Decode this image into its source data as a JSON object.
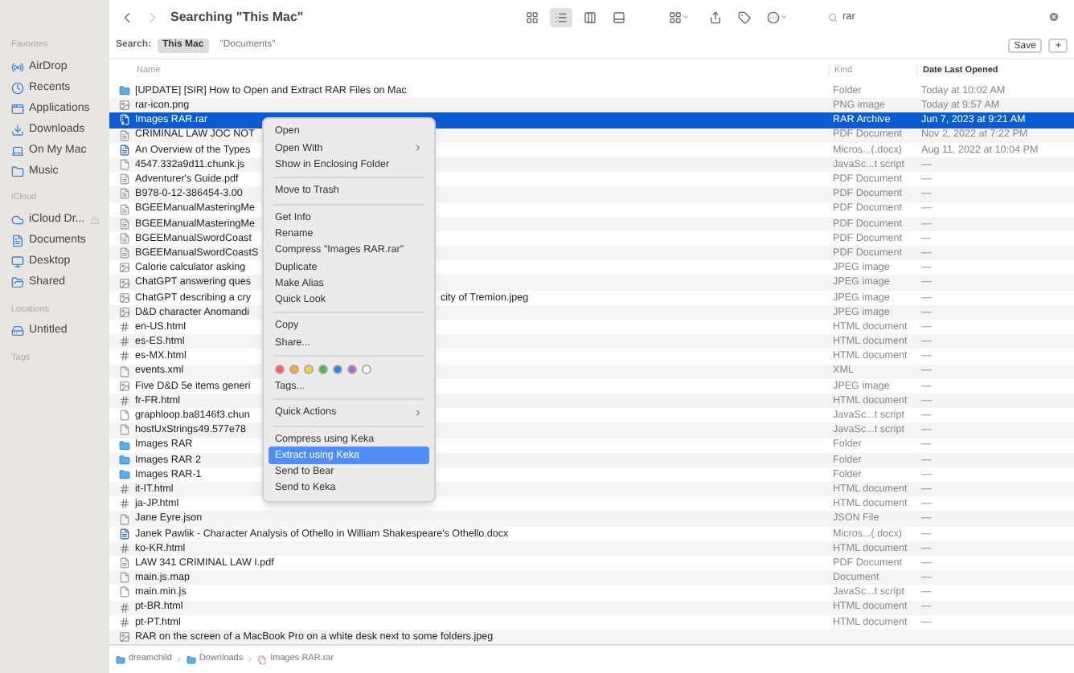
{
  "window": {
    "title": "Searching \"This Mac\""
  },
  "sidebar": {
    "sections": [
      {
        "title": "Favorites",
        "items": [
          {
            "label": "AirDrop"
          },
          {
            "label": "Recents"
          },
          {
            "label": "Applications"
          },
          {
            "label": "Downloads"
          },
          {
            "label": "On My Mac"
          },
          {
            "label": "Music"
          }
        ]
      },
      {
        "title": "iCloud",
        "items": [
          {
            "label": "iCloud Dr..."
          },
          {
            "label": "Documents"
          },
          {
            "label": "Desktop"
          },
          {
            "label": "Shared"
          }
        ]
      },
      {
        "title": "Locations",
        "items": [
          {
            "label": "Untitled"
          }
        ]
      },
      {
        "title": "Tags"
      }
    ]
  },
  "toolbar": {
    "views": [
      {
        "selected": false
      },
      {
        "selected": true
      },
      {
        "selected": false
      },
      {
        "selected": false
      }
    ],
    "search": {
      "value": "rar"
    }
  },
  "search_bar": {
    "label": "Search:",
    "scopes": [
      {
        "label": "This Mac",
        "selected": true
      },
      {
        "label": "\"Documents\"",
        "selected": false
      }
    ],
    "buttons": [
      "Save",
      "+"
    ]
  },
  "table": {
    "columns": [
      "Name",
      "Kind",
      "Date Last Opened"
    ],
    "rows": [
      {
        "kind": "folder",
        "name": "[UPDATE] [SIR] How to Open and Extract RAR Files on Mac",
        "file_type": "Folder",
        "date": "Today at 10:02 AM",
        "selected": false
      },
      {
        "kind": "image",
        "name": "rar-icon.png",
        "file_type": "PNG image",
        "date": "Today at 9:57 AM",
        "selected": false
      },
      {
        "kind": "archive",
        "name": "Images RAR.rar",
        "file_type": "RAR Archive",
        "date": "Jun 7, 2023 at 9:21 AM",
        "selected": true
      },
      {
        "kind": "pdf",
        "name": "CRIMINAL LAW JOC NOT",
        "file_type": "PDF Document",
        "date": "Nov 2, 2022 at 7:22 PM",
        "selected": false
      },
      {
        "kind": "word",
        "name": "An Overview of the Types",
        "file_type": "Micros...(.docx)",
        "date": "Aug 11, 2022 at 10:04 PM",
        "selected": false
      },
      {
        "kind": "script",
        "name": "4547.332a9d11.chunk.js",
        "file_type": "JavaSc...t script",
        "date": "—",
        "selected": false
      },
      {
        "kind": "pdf",
        "name": "Adventurer's Guide.pdf",
        "file_type": "PDF Document",
        "date": "—",
        "selected": false
      },
      {
        "kind": "pdf",
        "name": "B978-0-12-386454-3.00",
        "file_type": "PDF Document",
        "date": "—",
        "selected": false
      },
      {
        "kind": "pdf",
        "name": "BGEEManualMasteringMe",
        "file_type": "PDF Document",
        "date": "—",
        "selected": false
      },
      {
        "kind": "pdf",
        "name": "BGEEManualMasteringMe",
        "file_type": "PDF Document",
        "date": "—",
        "selected": false
      },
      {
        "kind": "pdf",
        "name": "BGEEManualSwordCoast",
        "file_type": "PDF Document",
        "date": "—",
        "selected": false
      },
      {
        "kind": "pdf",
        "name": "BGEEManualSwordCoastS",
        "file_type": "PDF Document",
        "date": "—",
        "selected": false
      },
      {
        "kind": "image",
        "name": "Calorie calculator asking",
        "file_type": "JPEG image",
        "date": "—",
        "selected": false
      },
      {
        "kind": "image",
        "name": "ChatGPT answering ques",
        "file_type": "JPEG image",
        "date": "—",
        "selected": false
      },
      {
        "kind": "image",
        "name": "ChatGPT describing a cry",
        "name_tail": "city of Tremion.jpeg",
        "file_type": "JPEG image",
        "date": "—",
        "selected": false
      },
      {
        "kind": "image",
        "name": "D&D character Anomandi",
        "file_type": "JPEG image",
        "date": "—",
        "selected": false
      },
      {
        "kind": "html",
        "name": "en-US.html",
        "file_type": "HTML document",
        "date": "—",
        "selected": false
      },
      {
        "kind": "html",
        "name": "es-ES.html",
        "file_type": "HTML document",
        "date": "—",
        "selected": false
      },
      {
        "kind": "html",
        "name": "es-MX.html",
        "file_type": "HTML document",
        "date": "—",
        "selected": false
      },
      {
        "kind": "script",
        "name": "events.xml",
        "file_type": "XML",
        "date": "—",
        "selected": false
      },
      {
        "kind": "image",
        "name": "Five D&D 5e items generi",
        "file_type": "JPEG image",
        "date": "—",
        "selected": false
      },
      {
        "kind": "html",
        "name": "fr-FR.html",
        "file_type": "HTML document",
        "date": "—",
        "selected": false
      },
      {
        "kind": "script",
        "name": "graphloop.ba8146f3.chun",
        "file_type": "JavaSc...t script",
        "date": "—",
        "selected": false
      },
      {
        "kind": "script",
        "name": "hostUxStrings49.577e78",
        "file_type": "JavaSc...t script",
        "date": "—",
        "selected": false
      },
      {
        "kind": "folder",
        "name": "Images RAR",
        "file_type": "Folder",
        "date": "—",
        "selected": false
      },
      {
        "kind": "folder",
        "name": "Images RAR 2",
        "file_type": "Folder",
        "date": "—",
        "selected": false
      },
      {
        "kind": "folder",
        "name": "Images RAR-1",
        "file_type": "Folder",
        "date": "—",
        "selected": false
      },
      {
        "kind": "html",
        "name": "it-IT.html",
        "file_type": "HTML document",
        "date": "—",
        "selected": false
      },
      {
        "kind": "html",
        "name": "ja-JP.html",
        "file_type": "HTML document",
        "date": "—",
        "selected": false
      },
      {
        "kind": "script",
        "name": "Jane Eyre.json",
        "file_type": "JSON File",
        "date": "—",
        "selected": false
      },
      {
        "kind": "word",
        "name": "Janek Pawlik - Character Analysis of Othello in William Shakespeare's Othello.docx",
        "file_type": "Micros...(.docx)",
        "date": "—",
        "selected": false
      },
      {
        "kind": "html",
        "name": "ko-KR.html",
        "file_type": "HTML document",
        "date": "—",
        "selected": false
      },
      {
        "kind": "pdf",
        "name": "LAW 341 CRIMINAL LAW I.pdf",
        "file_type": "PDF Document",
        "date": "—",
        "selected": false
      },
      {
        "kind": "script",
        "name": "main.js.map",
        "file_type": "Document",
        "date": "—",
        "selected": false
      },
      {
        "kind": "script",
        "name": "main.min.js",
        "file_type": "JavaSc...t script",
        "date": "—",
        "selected": false
      },
      {
        "kind": "html",
        "name": "pt-BR.html",
        "file_type": "HTML document",
        "date": "—",
        "selected": false
      },
      {
        "kind": "html",
        "name": "pt-PT.html",
        "file_type": "HTML document",
        "date": "—",
        "selected": false
      },
      {
        "kind": "image",
        "name": "RAR on the screen of a MacBook Pro on a white desk next to some folders.jpeg",
        "selected": false
      }
    ]
  },
  "context_menu": {
    "items": [
      {
        "kind": "item",
        "label": "Open",
        "submenu": false,
        "selected": false
      },
      {
        "kind": "item",
        "label": "Open With",
        "submenu": true,
        "selected": false
      },
      {
        "kind": "item",
        "label": "Show in Enclosing Folder",
        "submenu": false,
        "selected": false
      },
      {
        "kind": "separator"
      },
      {
        "kind": "item",
        "label": "Move to Trash",
        "submenu": false,
        "selected": false
      },
      {
        "kind": "separator"
      },
      {
        "kind": "item",
        "label": "Get Info",
        "submenu": false,
        "selected": false
      },
      {
        "kind": "item",
        "label": "Rename",
        "submenu": false,
        "selected": false
      },
      {
        "kind": "item",
        "label": "Compress \"Images RAR.rar\"",
        "submenu": false,
        "selected": false
      },
      {
        "kind": "item",
        "label": "Duplicate",
        "submenu": false,
        "selected": false
      },
      {
        "kind": "item",
        "label": "Make Alias",
        "submenu": false,
        "selected": false
      },
      {
        "kind": "item",
        "label": "Quick Look",
        "submenu": false,
        "selected": false
      },
      {
        "kind": "separator"
      },
      {
        "kind": "item",
        "label": "Copy",
        "submenu": false,
        "selected": false
      },
      {
        "kind": "item",
        "label": "Share...",
        "submenu": false,
        "selected": false
      },
      {
        "kind": "separator"
      },
      {
        "kind": "tags",
        "colors": [
          {
            "color": "#ff5f57"
          },
          {
            "color": "#fba93a"
          },
          {
            "color": "#f8d23a"
          },
          {
            "color": "#3fc04c"
          },
          {
            "color": "#2b86f0"
          },
          {
            "color": "#b566d6"
          },
          {
            "color": "#ffffff"
          }
        ]
      },
      {
        "kind": "item",
        "label": "Tags...",
        "submenu": false,
        "selected": false
      },
      {
        "kind": "separator"
      },
      {
        "kind": "item",
        "label": "Quick Actions",
        "submenu": true,
        "selected": false
      },
      {
        "kind": "separator"
      },
      {
        "kind": "item",
        "label": "Compress using Keka",
        "submenu": false,
        "selected": false
      },
      {
        "kind": "item",
        "label": "Extract using Keka",
        "submenu": false,
        "selected": true
      },
      {
        "kind": "item",
        "label": "Send to Bear",
        "submenu": false,
        "selected": false
      },
      {
        "kind": "item",
        "label": "Send to Keka",
        "submenu": false,
        "selected": false
      }
    ]
  },
  "path_bar": [
    {
      "kind": "folder",
      "label": "dreamchild"
    },
    {
      "kind": "folder",
      "label": "Downloads"
    },
    {
      "kind": "archive",
      "label": "Images RAR.rar"
    }
  ]
}
